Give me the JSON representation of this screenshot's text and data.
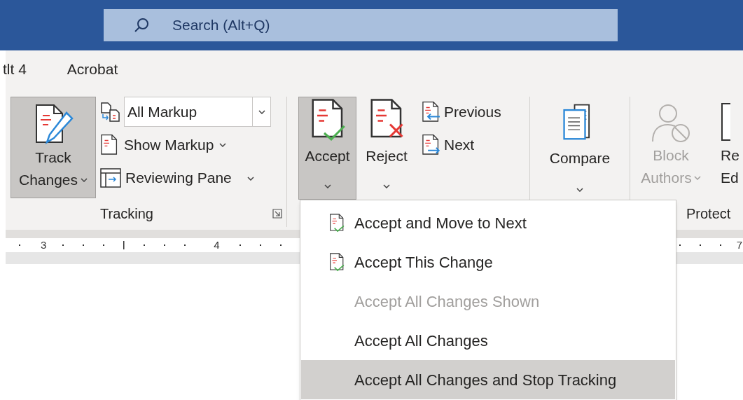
{
  "title_bar": {
    "search": {
      "placeholder": "Search (Alt+Q)"
    }
  },
  "tabs": [
    {
      "label": "tlt 4"
    },
    {
      "label": "Acrobat"
    }
  ],
  "ribbon": {
    "tracking": {
      "label": "Tracking",
      "track_changes": {
        "lines": [
          "Track",
          "Changes"
        ],
        "selected": true
      },
      "markup_dropdown": {
        "value": "All Markup"
      },
      "show_markup": {
        "label": "Show Markup"
      },
      "reviewing_pane": {
        "label": "Reviewing Pane"
      }
    },
    "changes": {
      "accept": {
        "label": "Accept",
        "selected": true
      },
      "reject": {
        "label": "Reject",
        "selected": false
      },
      "previous": {
        "label": "Previous"
      },
      "next": {
        "label": "Next"
      }
    },
    "compare": {
      "label": "Compare"
    },
    "protect": {
      "label": "Protect",
      "block_authors": {
        "lines": [
          "Block",
          "Authors"
        ],
        "disabled": true
      },
      "restrict_editing": {
        "lines": [
          "Re",
          "Ed"
        ],
        "disabled": false
      }
    }
  },
  "ruler": {
    "labels": [
      "3",
      "4",
      "7"
    ]
  },
  "accept_menu": {
    "items": [
      {
        "label": "Accept and Move to Next",
        "has_icon": true,
        "disabled": false,
        "selected": false
      },
      {
        "label": "Accept This Change",
        "has_icon": true,
        "disabled": false,
        "selected": false
      },
      {
        "label": "Accept All Changes Shown",
        "has_icon": false,
        "disabled": true,
        "selected": false
      },
      {
        "label": "Accept All Changes",
        "has_icon": false,
        "disabled": false,
        "selected": false
      },
      {
        "label": "Accept All Changes and Stop Tracking",
        "has_icon": false,
        "disabled": false,
        "selected": true
      }
    ]
  }
}
